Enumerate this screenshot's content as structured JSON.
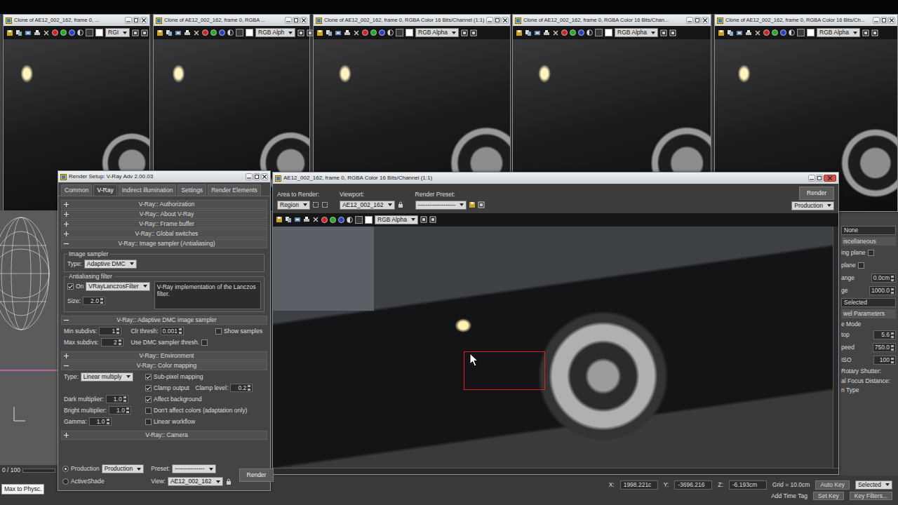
{
  "clone_windows": [
    {
      "title": "Clone of AE12_002_162, frame 0, ...",
      "channel": "RGI"
    },
    {
      "title": "Clone of AE12_002_162, frame 0, RGBA ...",
      "channel": "RGB Alph"
    },
    {
      "title": "Clone of AE12_002_162, frame 0, RGBA Color 16 Bits/Channel (1:1)",
      "channel": "RGB Alpha"
    },
    {
      "title": "Clone of AE12_002_162, frame 0, RGBA Color 16 Bits/Chan...",
      "channel": "RGB Alpha"
    },
    {
      "title": "Clone of AE12_002_162, frame 0, RGBA Color 16 Bits/Ch...",
      "channel": "RGB Alpha"
    }
  ],
  "render_setup": {
    "title": "Render Setup: V-Ray Adv 2.00.03",
    "tabs": [
      {
        "label": "Common",
        "selected": false
      },
      {
        "label": "V-Ray",
        "selected": true
      },
      {
        "label": "Indirect illumination",
        "selected": false
      },
      {
        "label": "Settings",
        "selected": false
      },
      {
        "label": "Render Elements",
        "selected": false
      }
    ],
    "rollouts": [
      {
        "title": "V-Ray:: Authorization",
        "expanded": false,
        "kind": "plain"
      },
      {
        "title": "V-Ray:: About V-Ray",
        "expanded": false,
        "kind": "plain"
      },
      {
        "title": "V-Ray:: Frame buffer",
        "expanded": false,
        "kind": "plain"
      },
      {
        "title": "V-Ray:: Global switches",
        "expanded": false,
        "kind": "plain"
      },
      {
        "title": "V-Ray:: Image sampler (Antialiasing)",
        "expanded": true,
        "kind": "image_sampler",
        "group1": "Image sampler",
        "type_label": "Type:",
        "type_value": "Adaptive DMC",
        "group2": "Antialiasing filter",
        "on_label": "On",
        "on_checked": true,
        "filter": "VRayLanczosFilter",
        "description": "V-Ray implementation of the Lanczos filter.",
        "size_label": "Size:",
        "size_value": "2.0"
      },
      {
        "title": "V-Ray:: Adaptive DMC image sampler",
        "expanded": true,
        "kind": "dmc",
        "min_label": "Min subdivs:",
        "min_value": "1",
        "max_label": "Max subdivs:",
        "max_value": "2",
        "clr_label": "Clr thresh:",
        "clr_value": "0.001",
        "show_samples": {
          "label": "Show samples",
          "checked": false
        },
        "use_dmc": {
          "label": "Use DMC sampler thresh.",
          "checked": false
        }
      },
      {
        "title": "V-Ray:: Environment",
        "expanded": false,
        "kind": "plain"
      },
      {
        "title": "V-Ray:: Color mapping",
        "expanded": true,
        "kind": "color_mapping",
        "type_label": "Type:",
        "type_value": "Linear multiply",
        "fields": [
          {
            "label": "Dark multiplier:",
            "value": "1.0"
          },
          {
            "label": "Bright multiplier:",
            "value": "1.0"
          },
          {
            "label": "Gamma:",
            "value": "1.0"
          }
        ],
        "checks": [
          {
            "label": "Sub-pixel mapping",
            "checked": true
          },
          {
            "label": "Clamp output",
            "checked": true,
            "level_label": "Clamp level:",
            "level_value": "0.2"
          },
          {
            "label": "Affect background",
            "checked": true
          },
          {
            "label": "Don't affect colors (adaptation only)",
            "checked": false
          },
          {
            "label": "Linear workflow",
            "checked": false
          }
        ]
      },
      {
        "title": "V-Ray:: Camera",
        "expanded": false,
        "kind": "plain"
      }
    ],
    "bottom": {
      "modes": [
        {
          "label": "Production",
          "selected": true
        },
        {
          "label": "ActiveShade",
          "selected": false
        }
      ],
      "mode_value": "Production",
      "preset_label": "Preset:",
      "preset_value": "---------------",
      "view_label": "View:",
      "view_value": "AE12_002_162",
      "render": "Render"
    }
  },
  "frame_window": {
    "title": "AE12_002_162, frame 0, RGBA Color 16 Bits/Channel (1:1)",
    "area_label": "Area to Render:",
    "area_value": "Region",
    "viewport_label": "Viewport:",
    "viewport_value": "AE12_002_162",
    "preset_label": "Render Preset:",
    "preset_value": "-------------------",
    "render": "Render",
    "mode_value": "Production",
    "channel": "RGB Alpha"
  },
  "side_panel": {
    "items": [
      {
        "kind": "value",
        "text": "None"
      },
      {
        "kind": "header",
        "text": "iscellaneous"
      },
      {
        "kind": "check",
        "label": "ing plane",
        "checked": false
      },
      {
        "kind": "check",
        "label": "plane",
        "checked": false
      },
      {
        "kind": "field",
        "label": "ange",
        "value": "0.0cm"
      },
      {
        "kind": "field",
        "label": "ge",
        "value": "1000.0"
      },
      {
        "kind": "value",
        "text": "Selected"
      },
      {
        "kind": "header",
        "text": "wel Parameters"
      },
      {
        "kind": "label",
        "text": "e Mode"
      },
      {
        "kind": "field",
        "label": "top",
        "value": "5.6"
      },
      {
        "kind": "field",
        "label": "peed",
        "value": "750.0"
      },
      {
        "kind": "field",
        "label": "ISO",
        "value": "100"
      },
      {
        "kind": "label",
        "text": "Rotary Shutter:"
      },
      {
        "kind": "label",
        "text": "al Focus Distance:"
      },
      {
        "kind": "label",
        "text": "n Type"
      }
    ]
  },
  "viewport": {
    "timeline": "0 / 100"
  },
  "status": {
    "left": "Max to Physc.",
    "coords": [
      {
        "label": "X:",
        "value": "1998.221c"
      },
      {
        "label": "Y:",
        "value": "-3696.216"
      },
      {
        "label": "Z:",
        "value": "-6.193cm"
      }
    ],
    "grid": "Grid = 10.0cm",
    "time_tag": "Add Time Tag",
    "auto_key": "Auto Key",
    "key_mode": "Selected",
    "set_key": "Set Key",
    "key_filters": "Key Filters..."
  }
}
